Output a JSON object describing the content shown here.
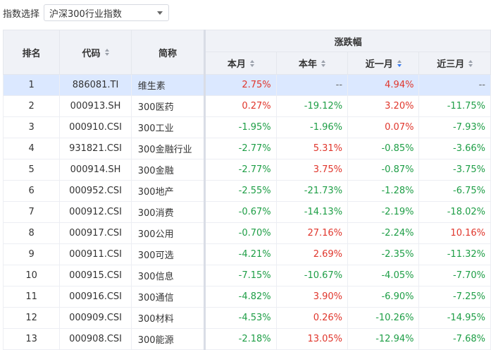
{
  "selector": {
    "label": "指数选择",
    "value": "沪深300行业指数"
  },
  "table": {
    "headers": {
      "rank": "排名",
      "code": "代码",
      "name": "简称",
      "group": "涨跌幅",
      "month": "本月",
      "year": "本年",
      "last_month": "近一月",
      "last_3m": "近三月"
    },
    "rows": [
      {
        "rank": "1",
        "code": "886081.TI",
        "name": "维生素",
        "month": "2.75%",
        "year": "--",
        "last_month": "4.94%",
        "last_3m": "--"
      },
      {
        "rank": "2",
        "code": "000913.SH",
        "name": "300医药",
        "month": "0.27%",
        "year": "-19.12%",
        "last_month": "3.20%",
        "last_3m": "-11.75%"
      },
      {
        "rank": "3",
        "code": "000910.CSI",
        "name": "300工业",
        "month": "-1.95%",
        "year": "-1.96%",
        "last_month": "0.07%",
        "last_3m": "-7.93%"
      },
      {
        "rank": "4",
        "code": "931821.CSI",
        "name": "300金融行业",
        "month": "-2.77%",
        "year": "5.31%",
        "last_month": "-0.85%",
        "last_3m": "-3.66%"
      },
      {
        "rank": "5",
        "code": "000914.SH",
        "name": "300金融",
        "month": "-2.77%",
        "year": "3.75%",
        "last_month": "-0.87%",
        "last_3m": "-3.75%"
      },
      {
        "rank": "6",
        "code": "000952.CSI",
        "name": "300地产",
        "month": "-2.55%",
        "year": "-21.73%",
        "last_month": "-1.28%",
        "last_3m": "-6.75%"
      },
      {
        "rank": "7",
        "code": "000912.CSI",
        "name": "300消费",
        "month": "-0.67%",
        "year": "-14.13%",
        "last_month": "-2.19%",
        "last_3m": "-18.02%"
      },
      {
        "rank": "8",
        "code": "000917.CSI",
        "name": "300公用",
        "month": "-0.70%",
        "year": "27.16%",
        "last_month": "-2.24%",
        "last_3m": "10.16%"
      },
      {
        "rank": "9",
        "code": "000911.CSI",
        "name": "300可选",
        "month": "-4.21%",
        "year": "2.69%",
        "last_month": "-2.35%",
        "last_3m": "-11.32%"
      },
      {
        "rank": "10",
        "code": "000915.CSI",
        "name": "300信息",
        "month": "-7.15%",
        "year": "-10.67%",
        "last_month": "-4.05%",
        "last_3m": "-7.70%"
      },
      {
        "rank": "11",
        "code": "000916.CSI",
        "name": "300通信",
        "month": "-4.82%",
        "year": "3.90%",
        "last_month": "-6.90%",
        "last_3m": "-7.25%"
      },
      {
        "rank": "12",
        "code": "000909.CSI",
        "name": "300材料",
        "month": "-4.53%",
        "year": "0.26%",
        "last_month": "-10.26%",
        "last_3m": "-14.95%"
      },
      {
        "rank": "13",
        "code": "000908.CSI",
        "name": "300能源",
        "month": "-2.18%",
        "year": "13.05%",
        "last_month": "-12.94%",
        "last_3m": "-7.68%"
      }
    ],
    "selected_row": 0,
    "sorted_column": "last_month",
    "colors": {
      "up": "#e0362c",
      "down": "#1e9e46",
      "selected_row": "#dbe8ff",
      "header_bg": "#f0f2f7"
    }
  }
}
